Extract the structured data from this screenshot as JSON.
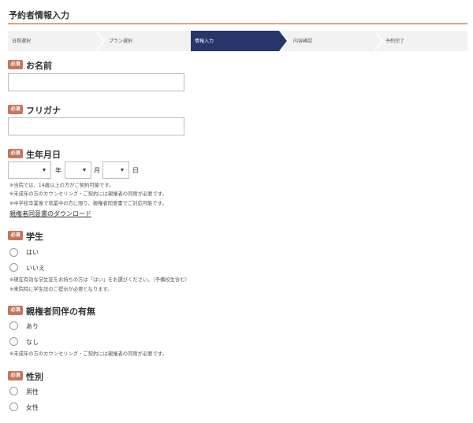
{
  "page_title": "予約者情報入力",
  "colors": {
    "accent_rule": "#d9a77f",
    "badge": "#c87559",
    "step_active": "#27356b",
    "step_inactive": "#f2f2f2"
  },
  "steps": [
    {
      "label": "日程選択",
      "active": false
    },
    {
      "label": "プラン選択",
      "active": false
    },
    {
      "label": "情報入力",
      "active": true
    },
    {
      "label": "内容確認",
      "active": false
    },
    {
      "label": "予約完了",
      "active": false
    }
  ],
  "required_badge": "必須",
  "name": {
    "label": "お名前",
    "value": ""
  },
  "furigana": {
    "label": "フリガナ",
    "value": ""
  },
  "birthdate": {
    "label": "生年月日",
    "year_unit": "年",
    "month_unit": "月",
    "day_unit": "日",
    "year_value": "",
    "month_value": "",
    "day_value": "",
    "notes": [
      "※当院では、14歳以上の方がご契約可能です。",
      "※未成年の方のカウンセリング・ご契約には親権者の同席が必要です。",
      "※中学校卒業後で就業中の方に限り、親権者同意書でご対応可能です。"
    ],
    "consent_link": "親権者同意書のダウンロード"
  },
  "student": {
    "label": "学生",
    "options": [
      "はい",
      "いいえ"
    ],
    "notes": [
      "※現在有効な学生証をお持ちの方は「はい」をお選びください。（予備校生含む）",
      "※来院時に学生証のご提示が必要となります。"
    ]
  },
  "guardian": {
    "label": "親権者同伴の有無",
    "options": [
      "あり",
      "なし"
    ],
    "notes": [
      "※未成年の方のカウンセリング・ご契約には親権者の同席が必要です。"
    ]
  },
  "gender": {
    "label": "性別",
    "options": [
      "男性",
      "女性"
    ]
  }
}
